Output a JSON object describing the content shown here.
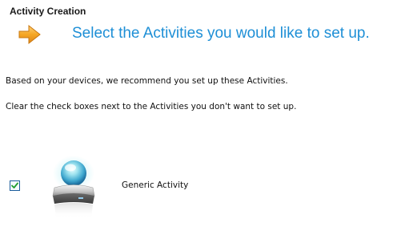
{
  "window": {
    "title": "Activity Creation"
  },
  "header": {
    "icon": "orange-arrow-icon",
    "headline": "Select the Activities you would like to set up.",
    "headline_color": "#1e8fd6",
    "arrow_color": "#f5a623"
  },
  "content": {
    "line1": "Based on your devices, we recommend you set up these Activities.",
    "line2": "Clear the check boxes next to the Activities you don't want to set up."
  },
  "activities": [
    {
      "label": "Generic Activity",
      "checked": true,
      "icon": "generic-activity-icon"
    }
  ]
}
